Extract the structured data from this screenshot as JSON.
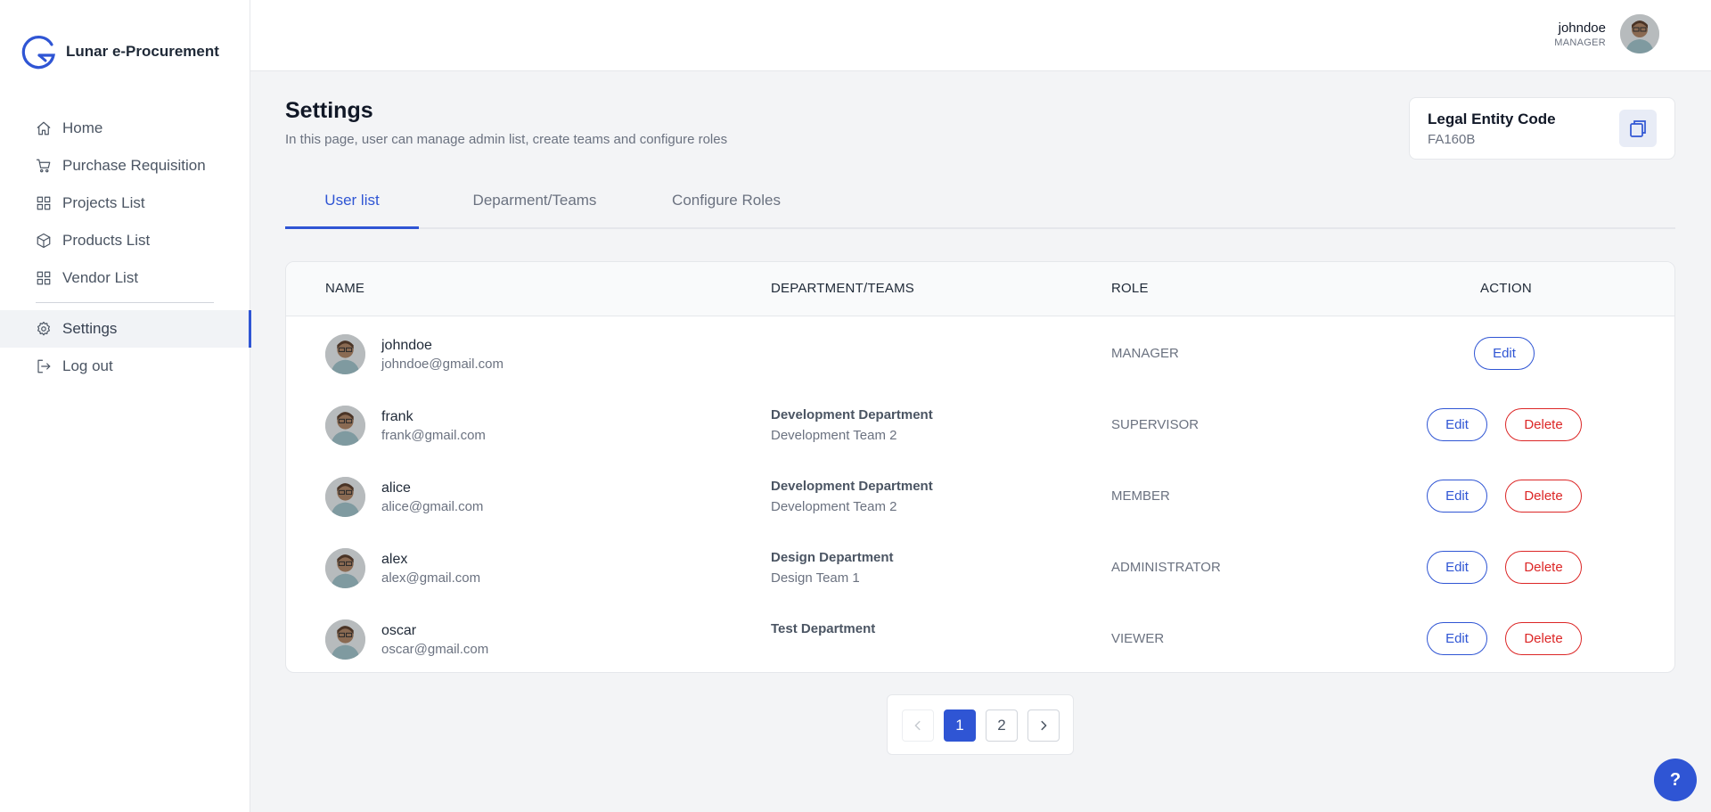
{
  "app": {
    "name": "Lunar e-Procurement",
    "logo_icon": "lunar-g-logo-icon"
  },
  "colors": {
    "accent": "#2f55d4",
    "danger": "#dc2626",
    "page_bg": "#f3f4f6"
  },
  "sidebar": {
    "items": [
      {
        "label": "Home",
        "icon": "home-icon"
      },
      {
        "label": "Purchase Requisition",
        "icon": "cart-icon"
      },
      {
        "label": "Projects List",
        "icon": "grid-icon"
      },
      {
        "label": "Products List",
        "icon": "box-icon"
      },
      {
        "label": "Vendor List",
        "icon": "grid-icon"
      },
      {
        "label": "Settings",
        "icon": "gear-icon",
        "active": true
      },
      {
        "label": "Log out",
        "icon": "logout-icon"
      }
    ]
  },
  "header": {
    "user_name": "johndoe",
    "user_role": "MANAGER"
  },
  "page": {
    "title": "Settings",
    "description": "In this page, user can manage admin list, create teams and configure roles"
  },
  "entity": {
    "label": "Legal Entity Code",
    "value": "FA160B"
  },
  "tabs": [
    {
      "label": "User list",
      "active": true
    },
    {
      "label": "Deparment/Teams"
    },
    {
      "label": "Configure Roles"
    }
  ],
  "table": {
    "headers": [
      "NAME",
      "DEPARTMENT/TEAMS",
      "ROLE",
      "ACTION"
    ],
    "rows": [
      {
        "name": "johndoe",
        "email": "johndoe@gmail.com",
        "department": "",
        "team": "",
        "role": "MANAGER",
        "edit": "Edit",
        "delete": ""
      },
      {
        "name": "frank",
        "email": "frank@gmail.com",
        "department": "Development Department",
        "team": "Development Team 2",
        "role": "SUPERVISOR",
        "edit": "Edit",
        "delete": "Delete"
      },
      {
        "name": "alice",
        "email": "alice@gmail.com",
        "department": "Development Department",
        "team": "Development Team 2",
        "role": "MEMBER",
        "edit": "Edit",
        "delete": "Delete"
      },
      {
        "name": "alex",
        "email": "alex@gmail.com",
        "department": "Design Department",
        "team": "Design Team 1",
        "role": "ADMINISTRATOR",
        "edit": "Edit",
        "delete": "Delete"
      },
      {
        "name": "oscar",
        "email": "oscar@gmail.com",
        "department": "Test Department",
        "team": "",
        "role": "VIEWER",
        "edit": "Edit",
        "delete": "Delete"
      }
    ]
  },
  "pagination": {
    "pages": [
      "1",
      "2"
    ],
    "current": "1"
  },
  "help": {
    "label": "?"
  }
}
